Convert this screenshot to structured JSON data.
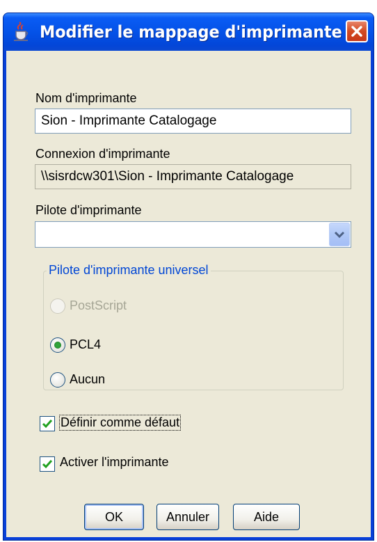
{
  "window": {
    "title": "Modifier le mappage d'imprimante"
  },
  "fields": {
    "printer_name": {
      "label": "Nom d'imprimante",
      "value": "Sion - Imprimante Catalogage"
    },
    "printer_connection": {
      "label": "Connexion d'imprimante",
      "value": "\\\\sisrdcw301\\Sion - Imprimante Catalogage"
    },
    "printer_driver": {
      "label": "Pilote d'imprimante",
      "value": ""
    }
  },
  "universal_driver": {
    "title": "Pilote d'imprimante universel",
    "options": [
      {
        "label": "PostScript",
        "selected": false,
        "enabled": false
      },
      {
        "label": "PCL4",
        "selected": true,
        "enabled": true
      },
      {
        "label": "Aucun",
        "selected": false,
        "enabled": true
      }
    ]
  },
  "checkboxes": {
    "set_default": {
      "label": "Définir comme défaut",
      "checked": true
    },
    "enable_printer": {
      "label": "Activer l'imprimante",
      "checked": true
    }
  },
  "buttons": {
    "ok": "OK",
    "cancel": "Annuler",
    "help": "Aide"
  },
  "colors": {
    "titlebar": "#0451e6",
    "client_bg": "#ece9d8",
    "group_title": "#0046d5",
    "radio_dot": "#31a43b",
    "check_mark": "#21a121",
    "close_button": "#d24a22"
  },
  "icons": {
    "app": "java-cup-icon",
    "close": "close-icon",
    "dropdown": "chevron-down-icon",
    "check": "checkmark-icon"
  }
}
